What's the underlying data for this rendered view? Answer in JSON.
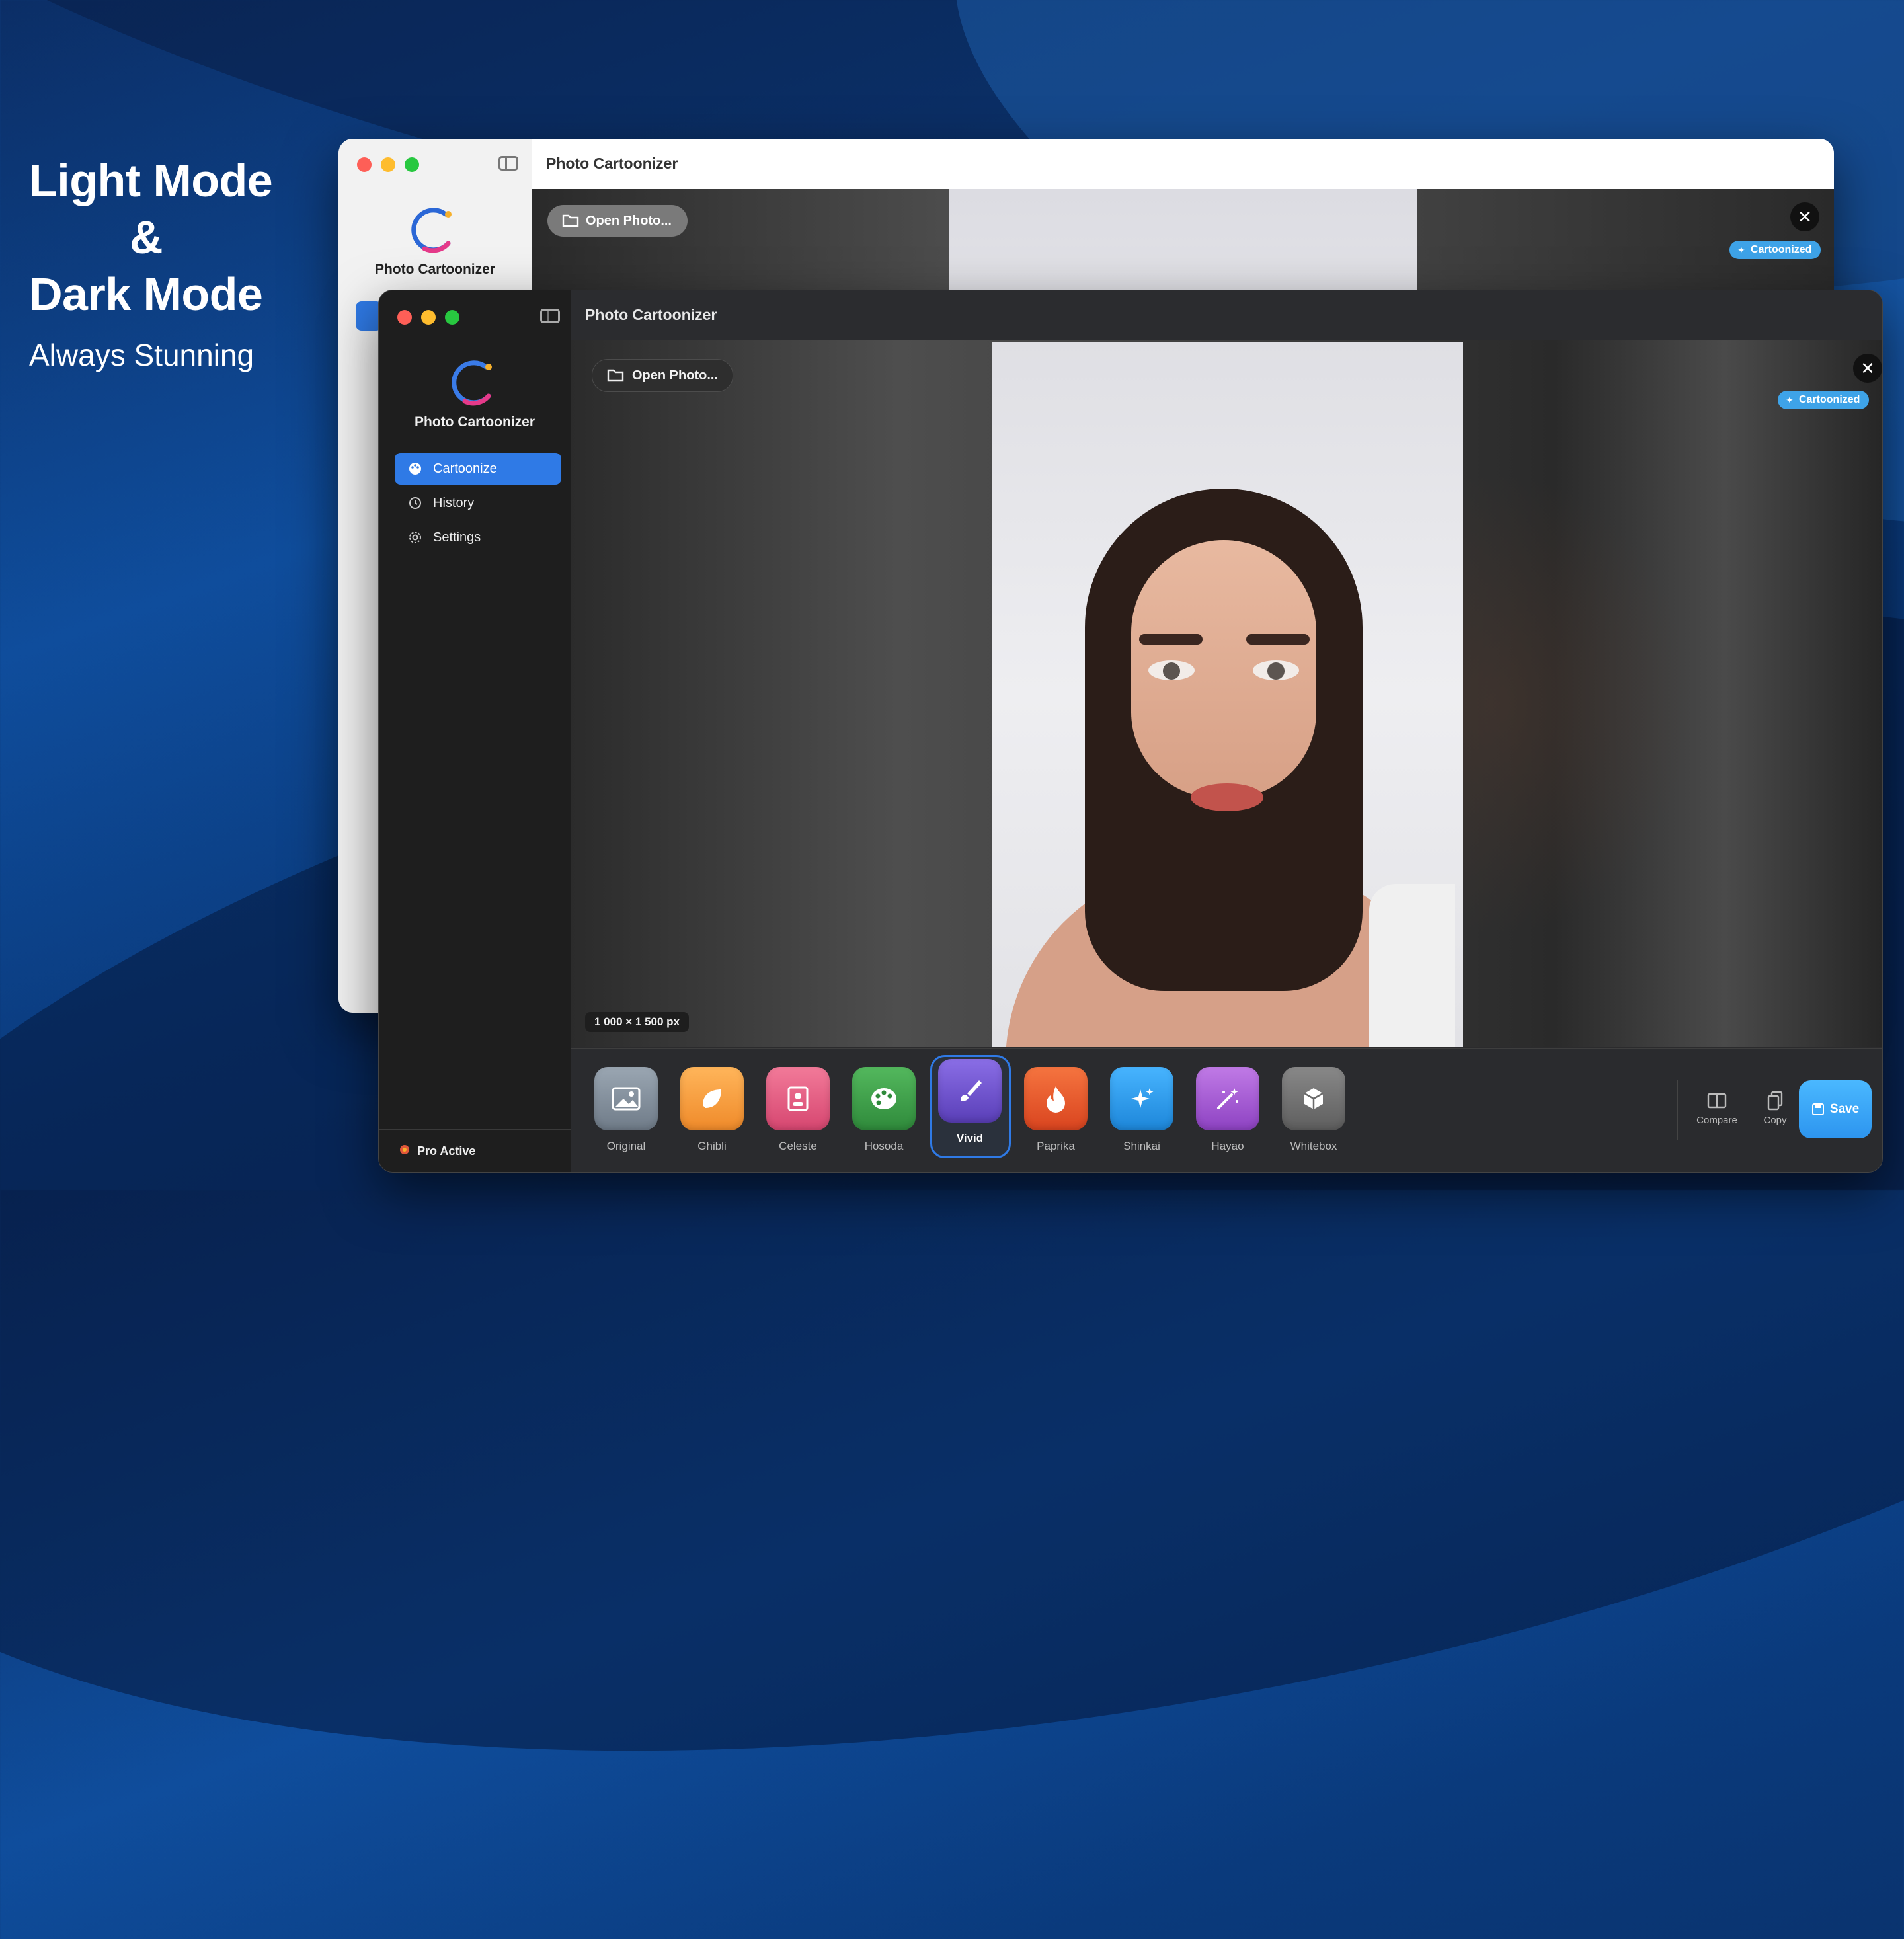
{
  "promo": {
    "line1": "Light Mode",
    "line2": "&",
    "line3": "Dark Mode",
    "subtitle": "Always Stunning"
  },
  "light_window": {
    "title": "Photo Cartoonizer",
    "app_name": "Photo Cartoonizer",
    "open_button": "Open Photo...",
    "badge": "Cartoonized",
    "close_symbol": "✕"
  },
  "dark_window": {
    "title": "Photo Cartoonizer",
    "app_name": "Photo Cartoonizer",
    "sidebar": {
      "items": [
        {
          "label": "Cartoonize",
          "icon": "palette-icon",
          "active": true
        },
        {
          "label": "History",
          "icon": "history-icon",
          "active": false
        },
        {
          "label": "Settings",
          "icon": "gear-icon",
          "active": false
        }
      ],
      "footer": "Pro Active"
    },
    "open_button": "Open Photo...",
    "badge": "Cartoonized",
    "close_symbol": "✕",
    "image_size": "1 000 × 1 500 px",
    "styles": [
      {
        "label": "Original",
        "icon": "image-icon",
        "color": "#8a96a3"
      },
      {
        "label": "Ghibli",
        "icon": "leaf-icon",
        "color": "#f59a3c"
      },
      {
        "label": "Celeste",
        "icon": "portrait-icon",
        "color": "#e4577a"
      },
      {
        "label": "Hosoda",
        "icon": "palette-icon",
        "color": "#3fa34d"
      },
      {
        "label": "Vivid",
        "icon": "brush-icon",
        "color": "#6a52c9",
        "selected": true
      },
      {
        "label": "Paprika",
        "icon": "flame-icon",
        "color": "#ec5a2e"
      },
      {
        "label": "Shinkai",
        "icon": "sparkle-icon",
        "color": "#2e9ff0"
      },
      {
        "label": "Hayao",
        "icon": "wand-icon",
        "color": "#a65ad8"
      },
      {
        "label": "Whitebox",
        "icon": "cube-icon",
        "color": "#707070"
      }
    ],
    "tools": {
      "compare": "Compare",
      "copy": "Copy",
      "save": "Save"
    }
  },
  "colors": {
    "accent": "#2f7ae6",
    "badge": "#3ea3e8",
    "save": "#2d95ef"
  }
}
